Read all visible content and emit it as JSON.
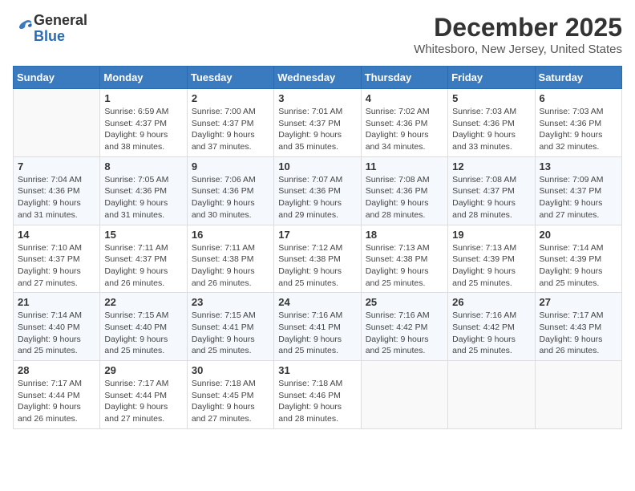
{
  "logo": {
    "general": "General",
    "blue": "Blue"
  },
  "title": "December 2025",
  "location": "Whitesboro, New Jersey, United States",
  "days_of_week": [
    "Sunday",
    "Monday",
    "Tuesday",
    "Wednesday",
    "Thursday",
    "Friday",
    "Saturday"
  ],
  "weeks": [
    [
      {
        "day": "",
        "info": ""
      },
      {
        "day": "1",
        "info": "Sunrise: 6:59 AM\nSunset: 4:37 PM\nDaylight: 9 hours\nand 38 minutes."
      },
      {
        "day": "2",
        "info": "Sunrise: 7:00 AM\nSunset: 4:37 PM\nDaylight: 9 hours\nand 37 minutes."
      },
      {
        "day": "3",
        "info": "Sunrise: 7:01 AM\nSunset: 4:37 PM\nDaylight: 9 hours\nand 35 minutes."
      },
      {
        "day": "4",
        "info": "Sunrise: 7:02 AM\nSunset: 4:36 PM\nDaylight: 9 hours\nand 34 minutes."
      },
      {
        "day": "5",
        "info": "Sunrise: 7:03 AM\nSunset: 4:36 PM\nDaylight: 9 hours\nand 33 minutes."
      },
      {
        "day": "6",
        "info": "Sunrise: 7:03 AM\nSunset: 4:36 PM\nDaylight: 9 hours\nand 32 minutes."
      }
    ],
    [
      {
        "day": "7",
        "info": "Sunrise: 7:04 AM\nSunset: 4:36 PM\nDaylight: 9 hours\nand 31 minutes."
      },
      {
        "day": "8",
        "info": "Sunrise: 7:05 AM\nSunset: 4:36 PM\nDaylight: 9 hours\nand 31 minutes."
      },
      {
        "day": "9",
        "info": "Sunrise: 7:06 AM\nSunset: 4:36 PM\nDaylight: 9 hours\nand 30 minutes."
      },
      {
        "day": "10",
        "info": "Sunrise: 7:07 AM\nSunset: 4:36 PM\nDaylight: 9 hours\nand 29 minutes."
      },
      {
        "day": "11",
        "info": "Sunrise: 7:08 AM\nSunset: 4:36 PM\nDaylight: 9 hours\nand 28 minutes."
      },
      {
        "day": "12",
        "info": "Sunrise: 7:08 AM\nSunset: 4:37 PM\nDaylight: 9 hours\nand 28 minutes."
      },
      {
        "day": "13",
        "info": "Sunrise: 7:09 AM\nSunset: 4:37 PM\nDaylight: 9 hours\nand 27 minutes."
      }
    ],
    [
      {
        "day": "14",
        "info": "Sunrise: 7:10 AM\nSunset: 4:37 PM\nDaylight: 9 hours\nand 27 minutes."
      },
      {
        "day": "15",
        "info": "Sunrise: 7:11 AM\nSunset: 4:37 PM\nDaylight: 9 hours\nand 26 minutes."
      },
      {
        "day": "16",
        "info": "Sunrise: 7:11 AM\nSunset: 4:38 PM\nDaylight: 9 hours\nand 26 minutes."
      },
      {
        "day": "17",
        "info": "Sunrise: 7:12 AM\nSunset: 4:38 PM\nDaylight: 9 hours\nand 25 minutes."
      },
      {
        "day": "18",
        "info": "Sunrise: 7:13 AM\nSunset: 4:38 PM\nDaylight: 9 hours\nand 25 minutes."
      },
      {
        "day": "19",
        "info": "Sunrise: 7:13 AM\nSunset: 4:39 PM\nDaylight: 9 hours\nand 25 minutes."
      },
      {
        "day": "20",
        "info": "Sunrise: 7:14 AM\nSunset: 4:39 PM\nDaylight: 9 hours\nand 25 minutes."
      }
    ],
    [
      {
        "day": "21",
        "info": "Sunrise: 7:14 AM\nSunset: 4:40 PM\nDaylight: 9 hours\nand 25 minutes."
      },
      {
        "day": "22",
        "info": "Sunrise: 7:15 AM\nSunset: 4:40 PM\nDaylight: 9 hours\nand 25 minutes."
      },
      {
        "day": "23",
        "info": "Sunrise: 7:15 AM\nSunset: 4:41 PM\nDaylight: 9 hours\nand 25 minutes."
      },
      {
        "day": "24",
        "info": "Sunrise: 7:16 AM\nSunset: 4:41 PM\nDaylight: 9 hours\nand 25 minutes."
      },
      {
        "day": "25",
        "info": "Sunrise: 7:16 AM\nSunset: 4:42 PM\nDaylight: 9 hours\nand 25 minutes."
      },
      {
        "day": "26",
        "info": "Sunrise: 7:16 AM\nSunset: 4:42 PM\nDaylight: 9 hours\nand 25 minutes."
      },
      {
        "day": "27",
        "info": "Sunrise: 7:17 AM\nSunset: 4:43 PM\nDaylight: 9 hours\nand 26 minutes."
      }
    ],
    [
      {
        "day": "28",
        "info": "Sunrise: 7:17 AM\nSunset: 4:44 PM\nDaylight: 9 hours\nand 26 minutes."
      },
      {
        "day": "29",
        "info": "Sunrise: 7:17 AM\nSunset: 4:44 PM\nDaylight: 9 hours\nand 27 minutes."
      },
      {
        "day": "30",
        "info": "Sunrise: 7:18 AM\nSunset: 4:45 PM\nDaylight: 9 hours\nand 27 minutes."
      },
      {
        "day": "31",
        "info": "Sunrise: 7:18 AM\nSunset: 4:46 PM\nDaylight: 9 hours\nand 28 minutes."
      },
      {
        "day": "",
        "info": ""
      },
      {
        "day": "",
        "info": ""
      },
      {
        "day": "",
        "info": ""
      }
    ]
  ]
}
